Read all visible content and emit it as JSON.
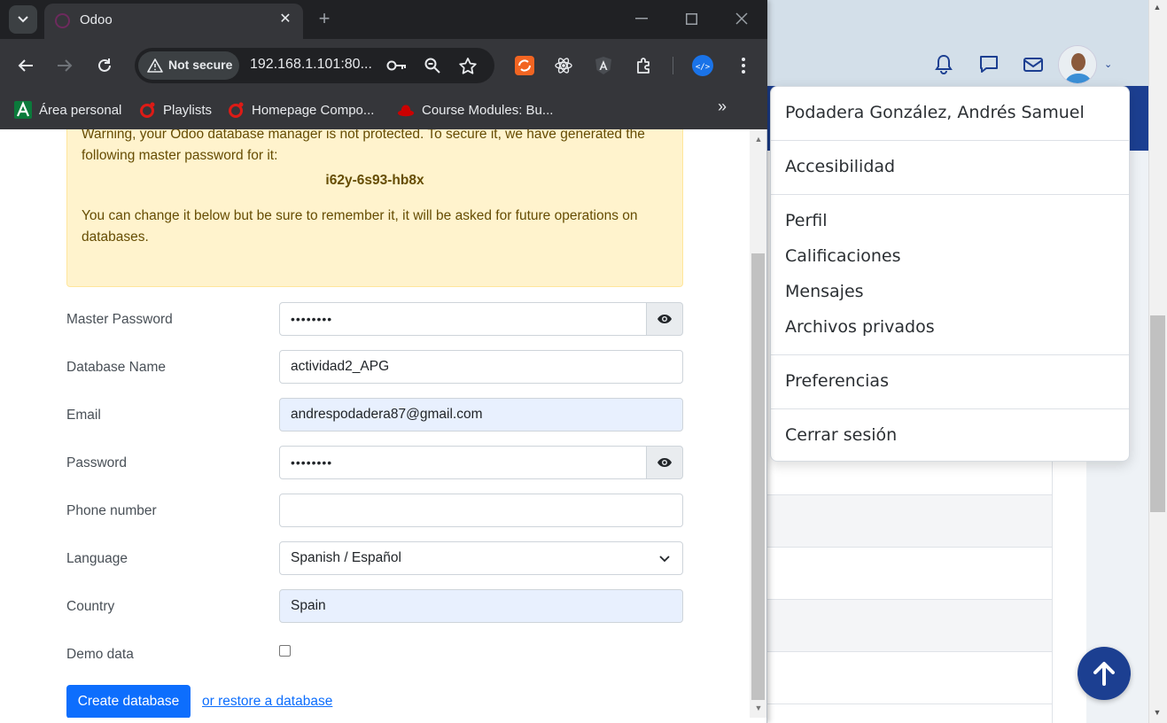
{
  "browser": {
    "tab_title": "Odoo",
    "security_label": "Not secure",
    "url": "192.168.1.101:80...",
    "bookmarks": [
      {
        "label": "Área personal"
      },
      {
        "label": "Playlists"
      },
      {
        "label": "Homepage Compo..."
      },
      {
        "label": "Course Modules: Bu..."
      }
    ],
    "bookmarks_more": "»"
  },
  "warning": {
    "text_1": "Warning, your Odoo database manager is not protected. To secure it, we have generated the following master password for it:",
    "master_password": "i62y-6s93-hb8x",
    "text_2": "You can change it below but be sure to remember it, it will be asked for future operations on databases."
  },
  "form": {
    "master_password": {
      "label": "Master Password",
      "value": "••••••••"
    },
    "database_name": {
      "label": "Database Name",
      "value": "actividad2_APG"
    },
    "email": {
      "label": "Email",
      "value": "andrespodadera87@gmail.com"
    },
    "password": {
      "label": "Password",
      "value": "••••••••"
    },
    "phone": {
      "label": "Phone number",
      "value": ""
    },
    "language": {
      "label": "Language",
      "value": "Spanish / Español"
    },
    "country": {
      "label": "Country",
      "value": "Spain"
    },
    "demo_data": {
      "label": "Demo data",
      "checked": false
    },
    "create_button": "Create database",
    "restore_link": "or restore a database"
  },
  "user_menu": {
    "user_name": "Podadera González, Andrés Samuel",
    "accessibility": "Accesibilidad",
    "profile": "Perfil",
    "grades": "Calificaciones",
    "messages": "Mensajes",
    "private_files": "Archivos privados",
    "preferences": "Preferencias",
    "logout": "Cerrar sesión"
  },
  "colors": {
    "primary": "#0d6efd",
    "moodle_navy": "#1c3f91",
    "warning_bg": "#fff3cd",
    "chrome_dark": "#202124"
  },
  "icons": [
    "bell-icon",
    "chat-icon",
    "mail-icon",
    "eye-icon",
    "arrow-up-icon",
    "key-icon",
    "zoom-icon",
    "star-icon",
    "extensions-icon"
  ]
}
